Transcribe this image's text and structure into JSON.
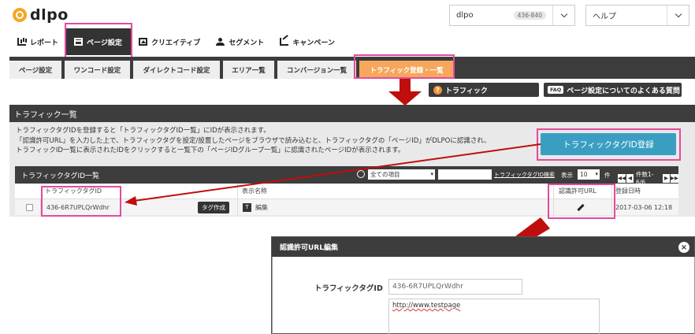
{
  "header": {
    "logo": "dlpo",
    "account_name": "dlpo",
    "account_id": "436-840",
    "help_label": "ヘルプ"
  },
  "main_nav": [
    {
      "label": "レポート",
      "icon": "report-icon"
    },
    {
      "label": "ページ設定",
      "icon": "page-icon"
    },
    {
      "label": "クリエイティブ",
      "icon": "creative-icon"
    },
    {
      "label": "セグメント",
      "icon": "segment-icon"
    },
    {
      "label": "キャンペーン",
      "icon": "campaign-icon"
    }
  ],
  "sub_nav": [
    {
      "label": "ページ設定"
    },
    {
      "label": "ワンコード設定"
    },
    {
      "label": "ダイレクトコード設定"
    },
    {
      "label": "エリア一覧"
    },
    {
      "label": "コンバージョン一覧"
    },
    {
      "label": "トラフィック登録・一覧"
    }
  ],
  "actions": {
    "traffic_label": "トラフィック",
    "faq_badge": "FAQ",
    "faq_label": "ページ設定についてのよくある質問"
  },
  "panel": {
    "title": "トラフィック一覧",
    "desc_line1": "トラフィックタグIDを登録すると「トラフィックタグID一覧」にIDが表示されます。",
    "desc_line2": "「認識許可URL」を入力した上で、トラフィックタグを設定/設置したページをブラウザで読み込むと、トラフィックタグの「ページID」がDLPOに認識され、",
    "desc_line3": "トラフィックID一覧に表示されたIDをクリックすると一覧下の「ページIDグループ一覧」に認識されたページIDが表示されます。",
    "register_button": "トラフィックタグID登録"
  },
  "list": {
    "title": "トラフィックタグID一覧",
    "filter_value": "全ての項目",
    "search_link": "トラフィックタグID検索",
    "display_label": "表示",
    "display_count": "10",
    "count_unit": "件",
    "page_info": "件数1-6/6",
    "columns": {
      "tag_id": "トラフィックタグID",
      "display_name": "表示名称",
      "allowed_url": "認識許可URL",
      "registered_at": "登録日時"
    },
    "rows": [
      {
        "tag_id": "436-6R7UPLQrWdhr",
        "tag_button": "タグ作成",
        "type_badge": "T",
        "display_name": "編集",
        "registered_at": "2017-03-06 12:18"
      }
    ]
  },
  "modal": {
    "title": "認識許可URL編集",
    "close": "×",
    "field_label": "トラフィックタグID",
    "field_value": "436-6R7UPLQrWdhr",
    "url_value": "http://www.testpage"
  },
  "colors": {
    "highlight": "#e44a9c",
    "arrow": "#c00d0d",
    "register_button": "#3a9ec2",
    "active_tab": "#f6a75c",
    "dark_bar": "#3c3c3c"
  }
}
